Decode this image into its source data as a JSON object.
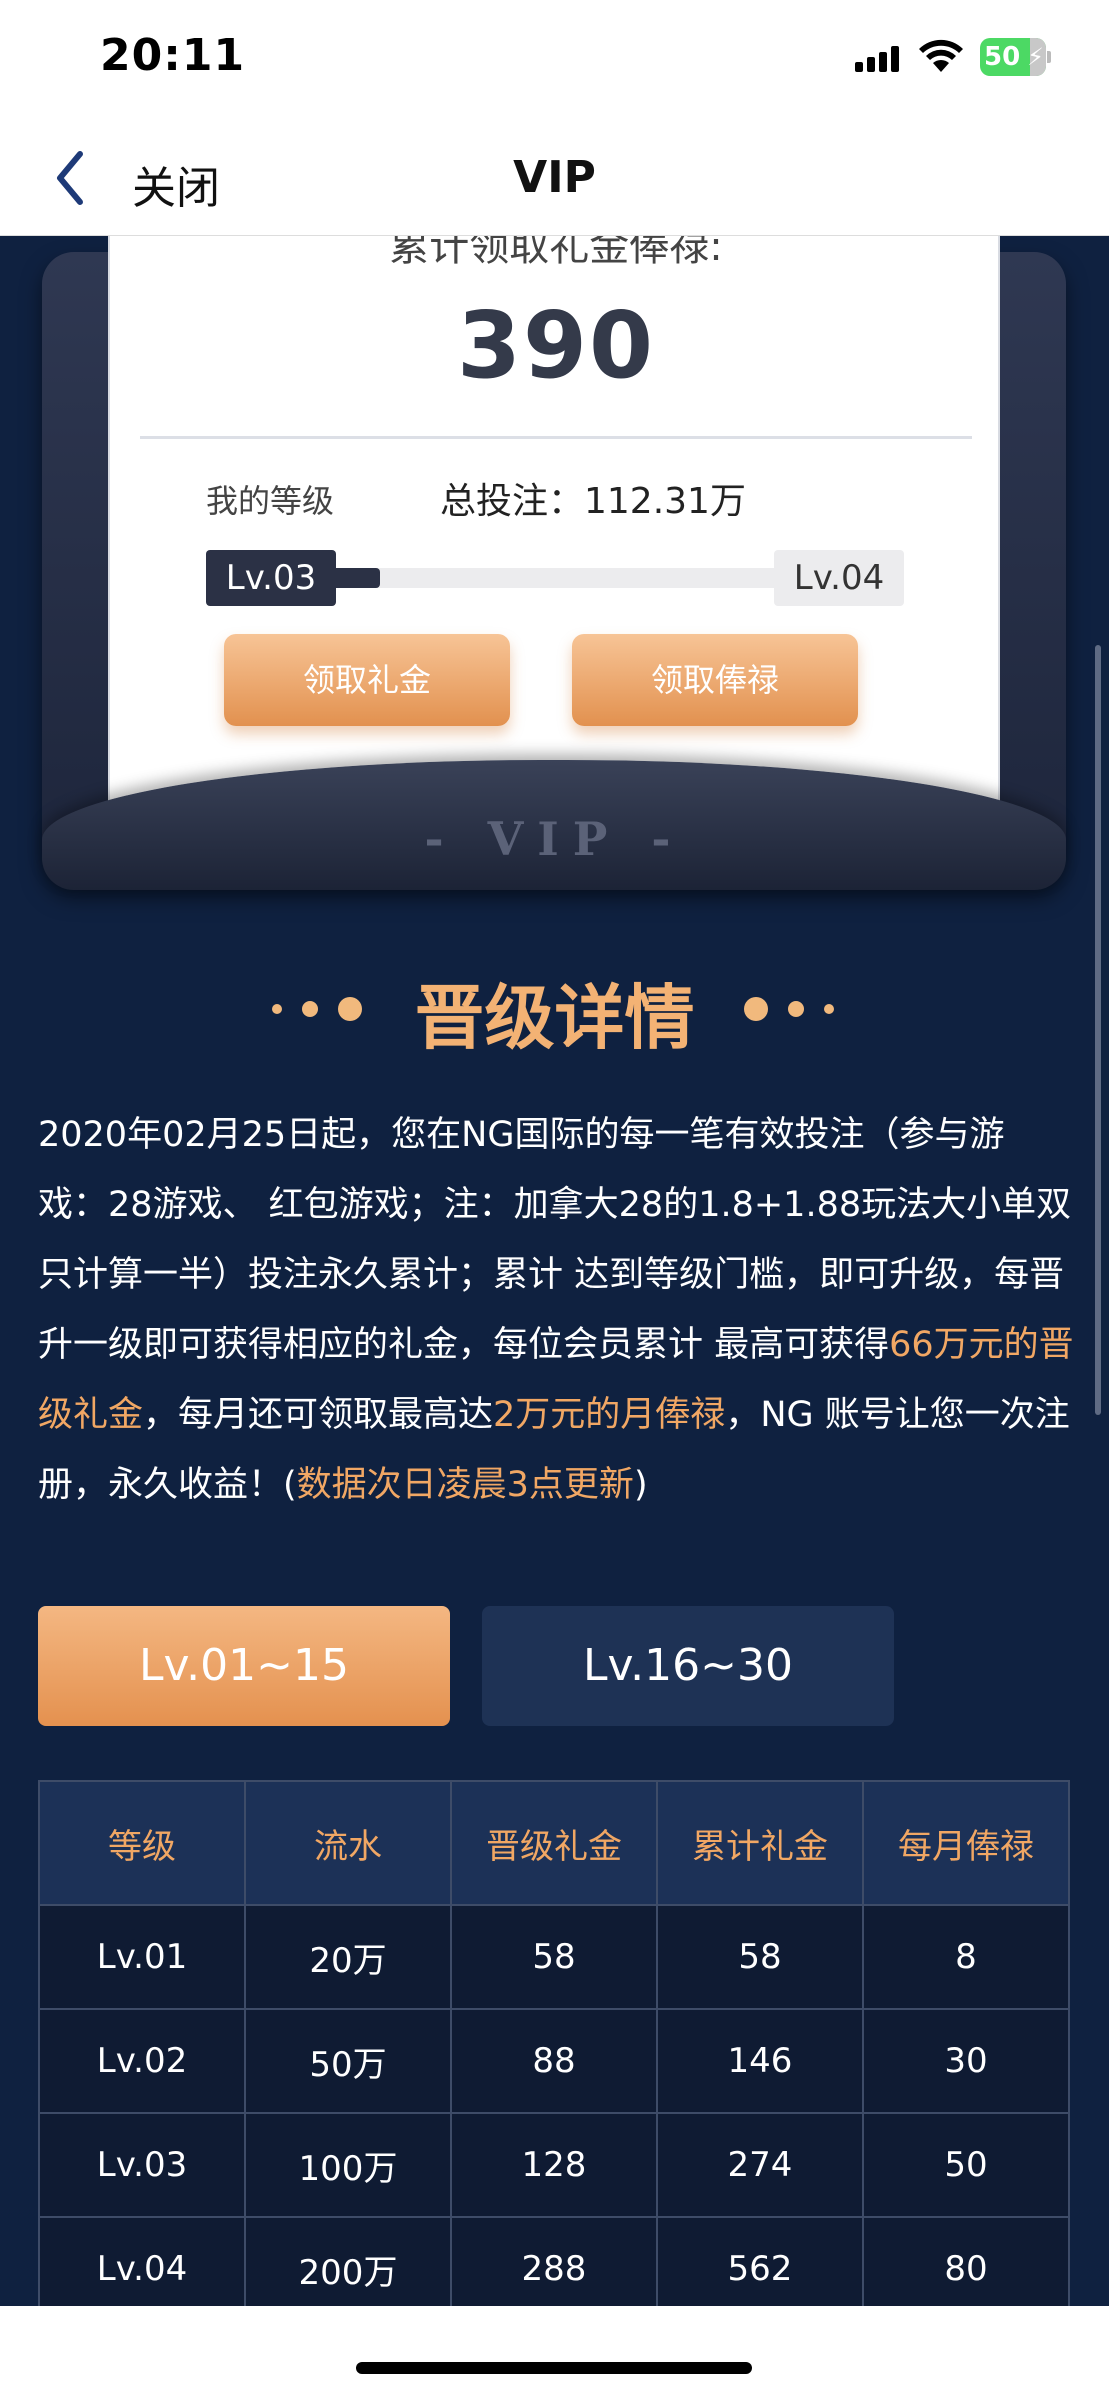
{
  "status_bar": {
    "time": "20:11",
    "battery": "50"
  },
  "nav": {
    "back_label": "关闭",
    "title": "VIP"
  },
  "card": {
    "subtitle": "累计领取礼金俸禄:",
    "amount": "390",
    "level_label": "我的等级",
    "total_bet": "总投注：112.31万",
    "current_level": "Lv.03",
    "next_level": "Lv.04",
    "progress": 0.1,
    "gift_button": "领取礼金",
    "salary_button": "领取俸禄",
    "vip_mark": "- VIP -"
  },
  "section": {
    "title": "晋级详情"
  },
  "description": {
    "p1": "2020年02月25日起，您在NG国际的每一笔有效投注（参与游戏：28游戏、 红包游戏；注：加拿大28的1.8+1.88玩法大小单双只计算一半）投注永久累计；累计 达到等级门槛，即可升级，每晋升一级即可获得相应的礼金，每位会员累计 最高可获得",
    "h1": "66万元的晋级礼金",
    "p2": "，每月还可领取最高达",
    "h2": "2万元的月俸禄",
    "p3": "，NG 账号让您一次注册，永久收益！(",
    "h3": "数据次日凌晨3点更新",
    "p4": ")"
  },
  "tabs": [
    {
      "label": "Lv.01~15",
      "active": true
    },
    {
      "label": "Lv.16~30",
      "active": false
    }
  ],
  "table": {
    "headers": [
      "等级",
      "流水",
      "晋级礼金",
      "累计礼金",
      "每月俸禄"
    ],
    "rows": [
      [
        "Lv.01",
        "20万",
        "58",
        "58",
        "8"
      ],
      [
        "Lv.02",
        "50万",
        "88",
        "146",
        "30"
      ],
      [
        "Lv.03",
        "100万",
        "128",
        "274",
        "50"
      ],
      [
        "Lv.04",
        "200万",
        "288",
        "562",
        "80"
      ]
    ]
  },
  "colors": {
    "accent": "#f1a764",
    "background": "#0f2140",
    "card_dark": "#2b3145"
  }
}
